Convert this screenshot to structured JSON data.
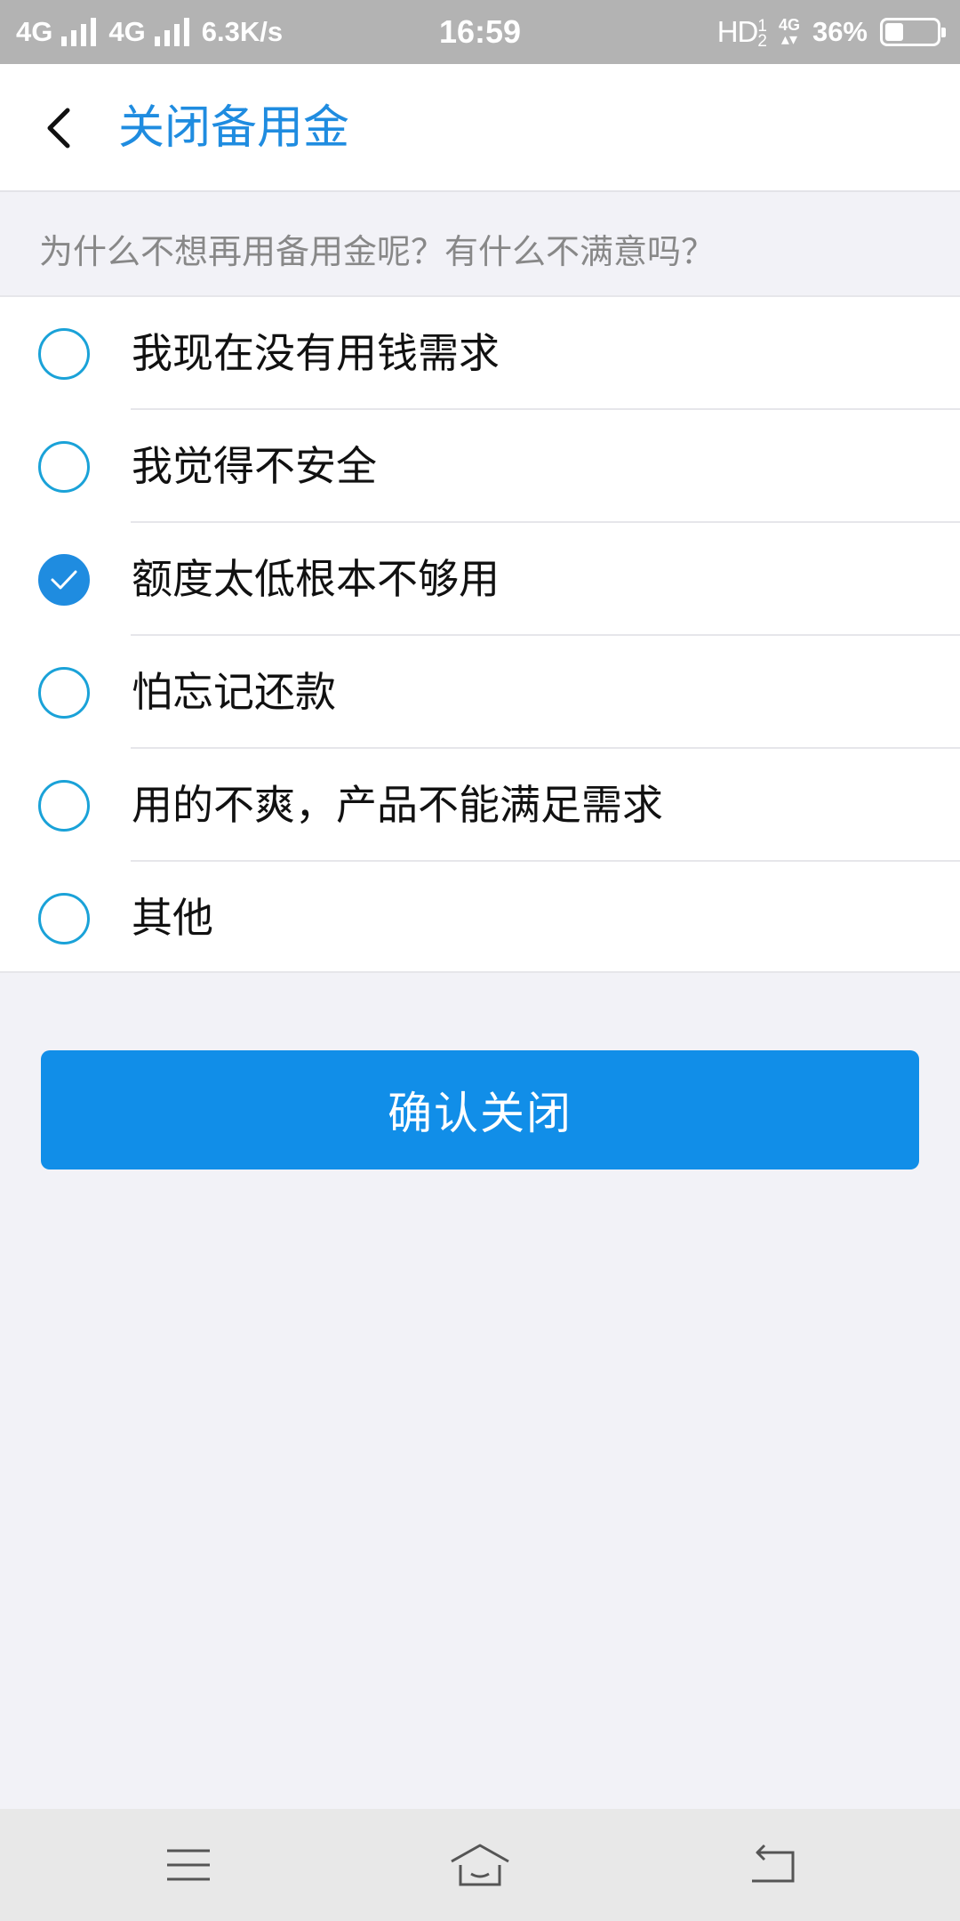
{
  "status_bar": {
    "network_1": "4G",
    "network_2": "4G",
    "speed": "6.3K/s",
    "time": "16:59",
    "hd": "HD",
    "hd_sup": "1",
    "hd_sub": "2",
    "mini_network": "4G",
    "battery_text": "36%",
    "battery_level_percent": 36
  },
  "header": {
    "title": "关闭备用金"
  },
  "prompt": "为什么不想再用备用金呢？有什么不满意吗？",
  "options": [
    {
      "label": "我现在没有用钱需求",
      "checked": false
    },
    {
      "label": "我觉得不安全",
      "checked": false
    },
    {
      "label": "额度太低根本不够用",
      "checked": true
    },
    {
      "label": "怕忘记还款",
      "checked": false
    },
    {
      "label": "用的不爽，产品不能满足需求",
      "checked": false
    },
    {
      "label": "其他",
      "checked": false
    }
  ],
  "confirm_label": "确认关闭",
  "colors": {
    "accent": "#1f8ce0",
    "button": "#118ee8"
  },
  "icons": {
    "back": "chevron-left-icon",
    "menu": "menu-icon",
    "home": "home-icon",
    "return": "return-icon",
    "check": "checkmark-icon"
  }
}
